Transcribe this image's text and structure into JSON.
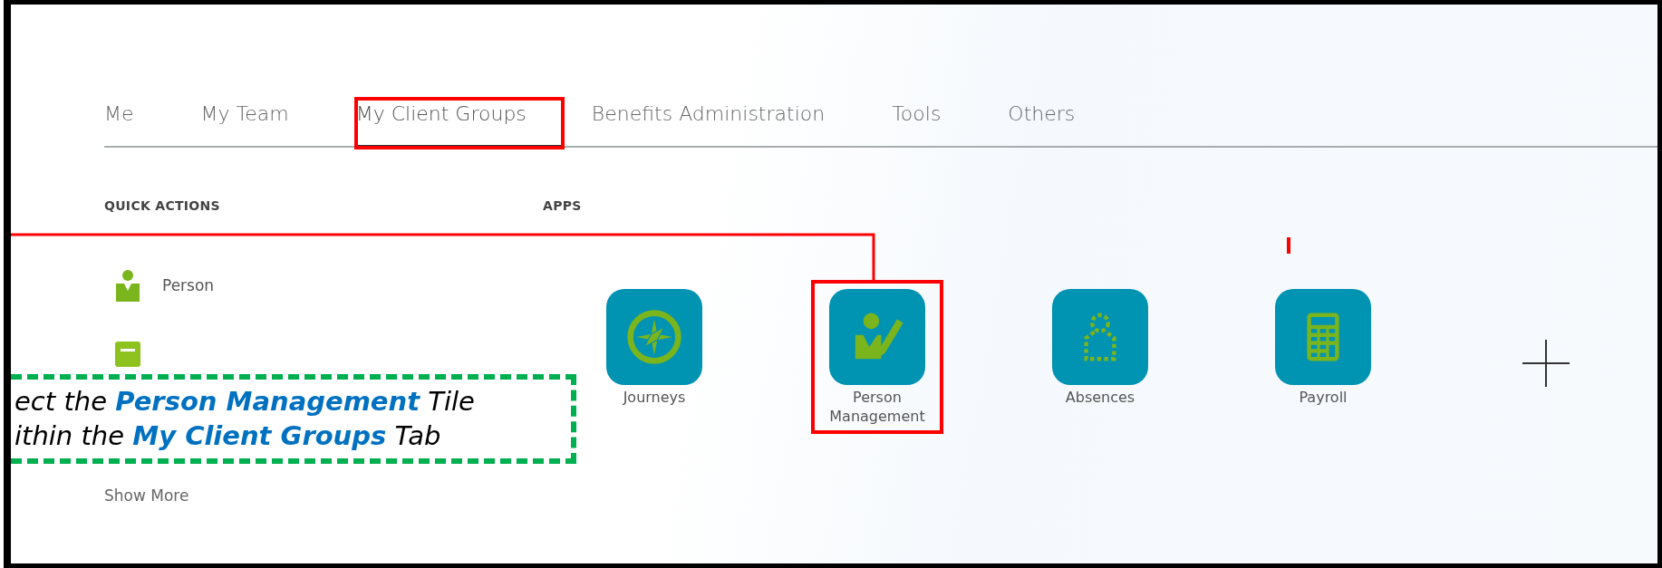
{
  "tabs": [
    {
      "label": "Me",
      "selected": false,
      "highlighted": false
    },
    {
      "label": "My Team",
      "selected": false,
      "highlighted": false
    },
    {
      "label": "My Client Groups",
      "selected": true,
      "highlighted": true
    },
    {
      "label": "Benefits Administration",
      "selected": false,
      "highlighted": false
    },
    {
      "label": "Tools",
      "selected": false,
      "highlighted": false
    },
    {
      "label": "Others",
      "selected": false,
      "highlighted": false
    }
  ],
  "quick_actions": {
    "heading": "QUICK ACTIONS",
    "items": [
      {
        "kind": "person",
        "label": "Person"
      },
      {
        "kind": "card"
      }
    ],
    "show_more": "Show More"
  },
  "apps": {
    "heading": "APPS",
    "tiles": [
      {
        "kind": "compass",
        "label": "Journeys",
        "highlighted": false
      },
      {
        "kind": "person-edit",
        "label": "Person Management",
        "highlighted": true
      },
      {
        "kind": "absence",
        "label": "Absences",
        "highlighted": false
      },
      {
        "kind": "calculator",
        "label": "Payroll",
        "highlighted": false
      }
    ]
  },
  "callout": {
    "lines": [
      "ect the **Person Management** Tile",
      "ithin the **My Client Groups** Tab"
    ]
  }
}
